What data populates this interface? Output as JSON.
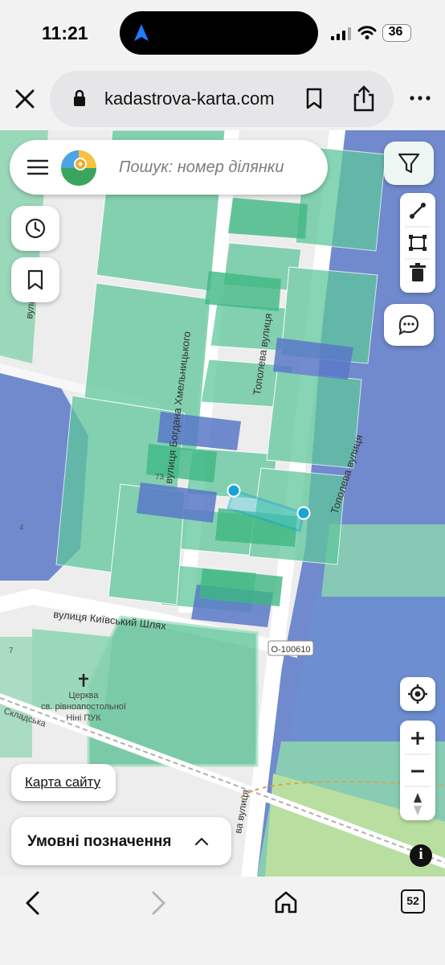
{
  "status_bar": {
    "time": "11:21",
    "battery": "36"
  },
  "browser": {
    "url": "kadastrova-karta.com",
    "tabs_count": "52"
  },
  "search": {
    "placeholder": "Пошук: номер ділянки"
  },
  "map": {
    "street_labels": {
      "bohdan_khmelnytsky": "вулиця Богдана Хмельницького",
      "topoleva_1": "Тополева вулиця",
      "topoleva_2": "Тополева вулиця",
      "kyivsky_shliakh": "вулиця Київський Шлях",
      "vulytsia_left": "вулиця",
      "vulytsia_bottom": "ва вулиця",
      "skladska": "Складська"
    },
    "road_ref": "О-100610",
    "church_label": [
      "Церква",
      "св. рівноапостольної",
      "Ніні ПУК"
    ],
    "house_numbers": [
      "73",
      "4",
      "7"
    ],
    "colors": {
      "parcel_green": "#5fc79c",
      "parcel_blue": "#5a78c8",
      "selection": "#1aa3d6",
      "road": "#ffffff",
      "field": "#b9dfa0"
    }
  },
  "ui": {
    "sitemap_link": "Карта сайту",
    "legend_label": "Умовні позначення",
    "info": "i"
  },
  "icons": [
    "navigation-arrow-icon",
    "close-icon",
    "lock-icon",
    "bookmark-icon",
    "share-icon",
    "more-icon",
    "menu-icon",
    "logo-icon",
    "filter-icon",
    "history-icon",
    "saved-icon",
    "measure-line-icon",
    "measure-area-icon",
    "trash-icon",
    "comment-icon",
    "locate-icon",
    "zoom-in-icon",
    "zoom-out-icon",
    "compass-icon",
    "chevron-up-icon",
    "back-icon",
    "forward-icon",
    "home-icon",
    "tabs-icon"
  ]
}
